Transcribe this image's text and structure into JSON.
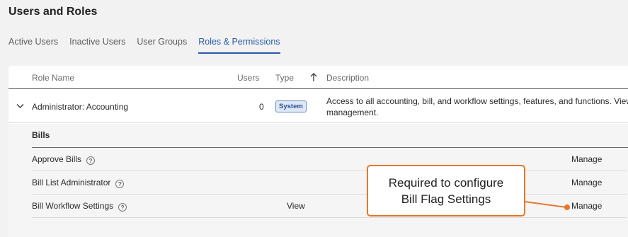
{
  "page": {
    "title": "Users and Roles"
  },
  "tabs": [
    {
      "label": "Active Users"
    },
    {
      "label": "Inactive Users"
    },
    {
      "label": "User Groups"
    },
    {
      "label": "Roles & Permissions"
    }
  ],
  "table": {
    "headers": {
      "role_name": "Role Name",
      "users": "Users",
      "type": "Type",
      "description": "Description"
    },
    "role": {
      "name": "Administrator: Accounting",
      "users": "0",
      "type_badge": "System",
      "description_line1": "Access to all accounting, bill, and workflow settings, features, and functions. View",
      "description_line2": "management."
    }
  },
  "permissions": {
    "section_title": "Bills",
    "rows": [
      {
        "name": "Approve Bills",
        "view": "",
        "manage": "Manage"
      },
      {
        "name": "Bill List Administrator",
        "view": "",
        "manage": "Manage"
      },
      {
        "name": "Bill Workflow Settings",
        "view": "View",
        "manage": "Manage"
      }
    ]
  },
  "callout": {
    "line1": "Required to configure",
    "line2": "Bill Flag Settings",
    "color": "#e8772a"
  },
  "colors": {
    "accent": "#2c5aa8",
    "callout": "#e8772a"
  }
}
